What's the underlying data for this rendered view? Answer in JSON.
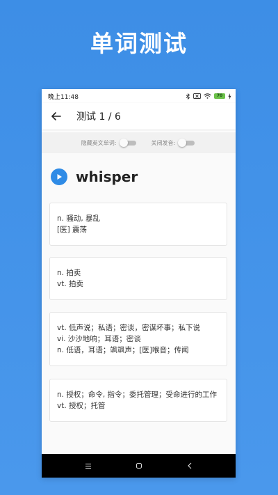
{
  "promo_title": "单词测试",
  "status_bar": {
    "time": "晚上11:48",
    "battery": "70"
  },
  "toolbar": {
    "title": "测试 1 / 6"
  },
  "settings": {
    "hide_english_label": "隐藏英文单词:",
    "mute_label": "关闭发音:",
    "hide_english_on": false,
    "mute_on": false
  },
  "word": "whisper",
  "options": [
    {
      "lines": [
        "n. 骚动, 暴乱",
        "[医] 震荡"
      ]
    },
    {
      "lines": [
        "n. 拍卖",
        "vt. 拍卖"
      ]
    },
    {
      "lines": [
        "vt. 低声说；私语；密谈，密谋坏事；私下说",
        "vi. 沙沙地响；耳语；密谈",
        "n. 低语，耳语；飒飒声；[医]喉音；传闻"
      ]
    },
    {
      "lines": [
        "n. 授权；命令, 指令；委托管理；受命进行的工作",
        "vt. 授权；托管"
      ]
    }
  ],
  "colors": {
    "accent": "#2f8be6",
    "background": "#4a98ec"
  }
}
